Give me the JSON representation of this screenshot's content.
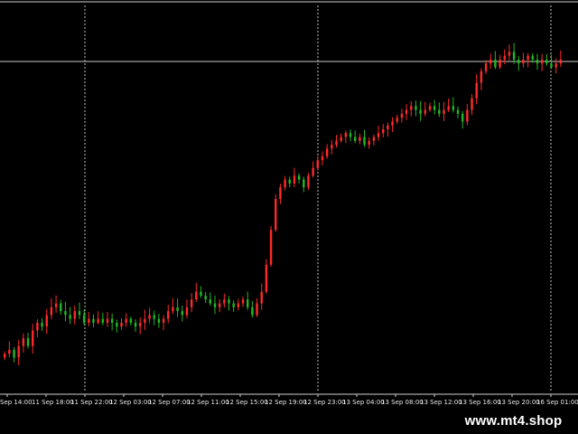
{
  "colors": {
    "background": "#000000",
    "up_candle": "#ff2a2a",
    "down_candle": "#22b822",
    "grid": "#bfbfbf",
    "axis": "#cfcfcf",
    "text": "#e8e8e8",
    "price_line": "#c8c8c8"
  },
  "watermark": "www.mt4.shop",
  "chart_data": {
    "type": "candlestick",
    "x_tick_labels": [
      "Sep 14:00",
      "11 Sep 18:00",
      "11 Sep 22:00",
      "12 Sep 03:00",
      "12 Sep 07:00",
      "12 Sep 11:00",
      "12 Sep 15:00",
      "12 Sep 19:00",
      "12 Sep 23:00",
      "13 Sep 04:00",
      "13 Sep 08:00",
      "13 Sep 12:00",
      "13 Sep 16:00",
      "13 Sep 20:00",
      "16 Sep 01:00"
    ],
    "vertical_grid_at_tick_index": [
      2,
      8,
      14
    ],
    "horizontal_line_level": 0.855,
    "ylim": [
      0,
      1
    ],
    "close_series": [
      0.1,
      0.11,
      0.09,
      0.12,
      0.14,
      0.12,
      0.16,
      0.18,
      0.17,
      0.2,
      0.22,
      0.23,
      0.21,
      0.2,
      0.19,
      0.21,
      0.2,
      0.18,
      0.19,
      0.18,
      0.19,
      0.18,
      0.19,
      0.18,
      0.17,
      0.18,
      0.19,
      0.18,
      0.17,
      0.18,
      0.19,
      0.2,
      0.19,
      0.18,
      0.19,
      0.21,
      0.22,
      0.21,
      0.2,
      0.22,
      0.24,
      0.26,
      0.25,
      0.24,
      0.23,
      0.22,
      0.23,
      0.24,
      0.23,
      0.22,
      0.23,
      0.24,
      0.22,
      0.2,
      0.23,
      0.26,
      0.33,
      0.42,
      0.5,
      0.53,
      0.55,
      0.54,
      0.56,
      0.55,
      0.53,
      0.56,
      0.58,
      0.6,
      0.61,
      0.63,
      0.64,
      0.65,
      0.66,
      0.67,
      0.66,
      0.65,
      0.66,
      0.64,
      0.65,
      0.66,
      0.67,
      0.68,
      0.69,
      0.7,
      0.71,
      0.72,
      0.73,
      0.74,
      0.73,
      0.72,
      0.73,
      0.74,
      0.73,
      0.72,
      0.73,
      0.74,
      0.73,
      0.72,
      0.7,
      0.73,
      0.76,
      0.8,
      0.83,
      0.85,
      0.86,
      0.84,
      0.86,
      0.87,
      0.88,
      0.86,
      0.85,
      0.86,
      0.87,
      0.86,
      0.85,
      0.86,
      0.85,
      0.84,
      0.85,
      0.86
    ]
  }
}
